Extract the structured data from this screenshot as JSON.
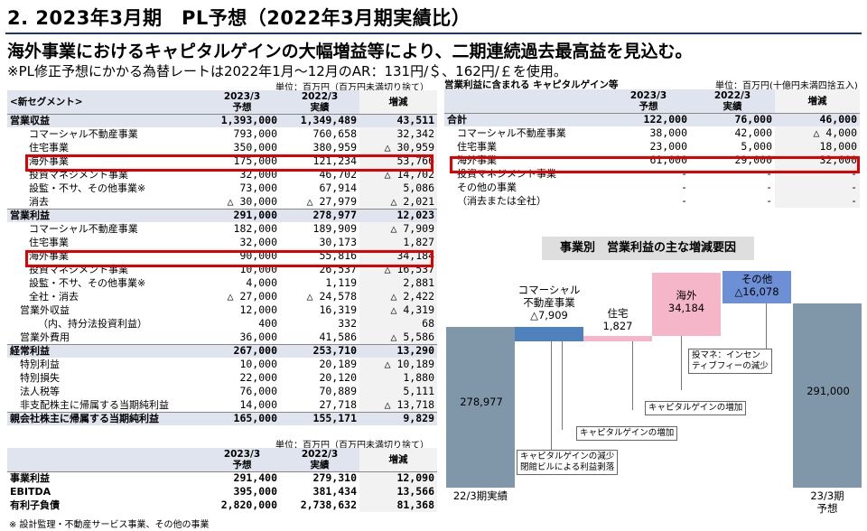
{
  "page": {
    "title": "2. 2023年3月期　PL予想（2022年3月期実績比）",
    "headline": "海外事業におけるキャピタルゲインの大幅増益等により、二期連続過去最高益を見込む。",
    "note": "※PL修正予想にかかる為替レートは2022年1月～12月のAR：131円/＄、162円/￡を使用。",
    "footnote": "※ 設計監理・不動産サービス事業、その他の事業"
  },
  "main_table": {
    "unit": "単位：百万円（百万円未満切り捨て）",
    "headers": [
      "<新セグメント>",
      "2023/3\n予想",
      "2022/3\n実績",
      "増減"
    ],
    "rows": [
      {
        "label": "営業収益",
        "v1": "1,393,000",
        "v2": "1,349,489",
        "v3": "43,511",
        "style": "bold"
      },
      {
        "label": "コマーシャル不動産事業",
        "v1": "793,000",
        "v2": "760,658",
        "v3": "32,342",
        "style": "i1"
      },
      {
        "label": "住宅事業",
        "v1": "350,000",
        "v2": "380,959",
        "v3": "△ 30,959",
        "style": "i1"
      },
      {
        "label": "海外事業",
        "v1": "175,000",
        "v2": "121,234",
        "v3": "53,766",
        "style": "i1"
      },
      {
        "label": "投資マネジメント事業",
        "v1": "32,000",
        "v2": "46,702",
        "v3": "△ 14,702",
        "style": "i1"
      },
      {
        "label": "設監・不サ、その他事業※",
        "v1": "73,000",
        "v2": "67,914",
        "v3": "5,086",
        "style": "i1"
      },
      {
        "label": "消去",
        "v1": "△ 30,000",
        "v2": "△ 27,979",
        "v3": "△ 2,021",
        "style": "i1"
      },
      {
        "label": "営業利益",
        "v1": "291,000",
        "v2": "278,977",
        "v3": "12,023",
        "style": "bold"
      },
      {
        "label": "コマーシャル不動産事業",
        "v1": "182,000",
        "v2": "189,909",
        "v3": "△ 7,909",
        "style": "i1"
      },
      {
        "label": "住宅事業",
        "v1": "32,000",
        "v2": "30,173",
        "v3": "1,827",
        "style": "i1"
      },
      {
        "label": "海外事業",
        "v1": "90,000",
        "v2": "55,816",
        "v3": "34,184",
        "style": "i1"
      },
      {
        "label": "投資マネジメント事業",
        "v1": "10,000",
        "v2": "26,537",
        "v3": "△ 16,537",
        "style": "i1"
      },
      {
        "label": "設監・不サ、その他事業※",
        "v1": "4,000",
        "v2": "1,119",
        "v3": "2,881",
        "style": "i1"
      },
      {
        "label": "全社・消去",
        "v1": "△ 27,000",
        "v2": "△ 24,578",
        "v3": "△ 2,422",
        "style": "i1"
      },
      {
        "label": "営業外収益",
        "v1": "12,000",
        "v2": "16,319",
        "v3": "△ 4,319",
        "style": "i0"
      },
      {
        "label": "（内、持分法投資利益）",
        "v1": "400",
        "v2": "332",
        "v3": "68",
        "style": "i2"
      },
      {
        "label": "営業外費用",
        "v1": "36,000",
        "v2": "41,586",
        "v3": "△ 5,586",
        "style": "i0"
      },
      {
        "label": "経常利益",
        "v1": "267,000",
        "v2": "253,710",
        "v3": "13,290",
        "style": "bold"
      },
      {
        "label": "特別利益",
        "v1": "10,000",
        "v2": "20,189",
        "v3": "△ 10,189",
        "style": "i0"
      },
      {
        "label": "特別損失",
        "v1": "22,000",
        "v2": "20,120",
        "v3": "1,880",
        "style": "i0"
      },
      {
        "label": "法人税等",
        "v1": "76,000",
        "v2": "70,889",
        "v3": "5,111",
        "style": "i0"
      },
      {
        "label": "非支配株主に帰属する当期純利益",
        "v1": "14,000",
        "v2": "27,718",
        "v3": "△ 13,718",
        "style": "i0"
      },
      {
        "label": "親会社株主に帰属する当期純利益",
        "v1": "165,000",
        "v2": "155,171",
        "v3": "9,829",
        "style": "bold"
      }
    ]
  },
  "small_table": {
    "unit": "単位：百万円（百万円未満切り捨て）",
    "headers": [
      "",
      "2023/3\n予想",
      "2022/3\n実績",
      "増減"
    ],
    "rows": [
      {
        "label": "事業利益",
        "v1": "291,400",
        "v2": "279,310",
        "v3": "12,090"
      },
      {
        "label": "EBITDA",
        "v1": "395,000",
        "v2": "381,434",
        "v3": "13,566"
      },
      {
        "label": "有利子負債",
        "v1": "2,820,000",
        "v2": "2,738,632",
        "v3": "81,368"
      }
    ]
  },
  "cg_table": {
    "title": "営業利益に含まれる キャピタルゲイン等",
    "unit": "単位：百万円(十億円未満四捨五入)",
    "headers": [
      "",
      "2023/3\n予想",
      "2022/3\n実績",
      "増減"
    ],
    "rows": [
      {
        "label": "合計",
        "v1": "122,000",
        "v2": "76,000",
        "v3": "46,000",
        "style": "bold"
      },
      {
        "label": "コマーシャル不動産事業",
        "v1": "38,000",
        "v2": "42,000",
        "v3": "△ 4,000",
        "style": "i1"
      },
      {
        "label": "住宅事業",
        "v1": "23,000",
        "v2": "5,000",
        "v3": "18,000",
        "style": "i1"
      },
      {
        "label": "海外事業",
        "v1": "61,000",
        "v2": "29,000",
        "v3": "32,000",
        "style": "i1"
      },
      {
        "label": "投資マネジメント事業",
        "v1": "-",
        "v2": "-",
        "v3": "-",
        "style": "i1"
      },
      {
        "label": "その他の事業",
        "v1": "-",
        "v2": "-",
        "v3": "-",
        "style": "i1"
      },
      {
        "label": "（消去または全社）",
        "v1": "-",
        "v2": "-",
        "v3": "-",
        "style": "i1"
      }
    ]
  },
  "waterfall": {
    "title": "事業別　営業利益の主な増減要因",
    "start_label": "278,977",
    "end_label": "291,000",
    "x_start": "22/3期実績",
    "x_end": "23/3期\n予想",
    "steps": [
      {
        "name": "コマーシャル\n不動産事業\n△7,909",
        "color": "#4f81bd"
      },
      {
        "name": "住宅\n1,827",
        "color": "#f4b6c8"
      },
      {
        "name": "海外\n34,184",
        "color": "#f4b6c8"
      },
      {
        "name": "その他\n△16,078",
        "color": "#6d8fd6"
      }
    ],
    "annotations": [
      "キャピタルゲインの減少\n閉館ビルによる利益剥落",
      "キャピタルゲインの増加",
      "キャピタルゲインの増加",
      "投マネ：インセン\nティブフィーの減少"
    ],
    "colors": {
      "total": "#7f97a8",
      "decrease": "#4f81bd",
      "increase": "#f4b6c8",
      "other": "#6d8fd6"
    }
  },
  "chart_data": {
    "type": "bar",
    "title": "事業別　営業利益の主な増減要因",
    "categories": [
      "22/3期実績",
      "コマーシャル不動産事業",
      "住宅",
      "海外",
      "その他",
      "23/3期予想"
    ],
    "values": [
      278977,
      -7909,
      1827,
      34184,
      -16078,
      291000
    ]
  }
}
